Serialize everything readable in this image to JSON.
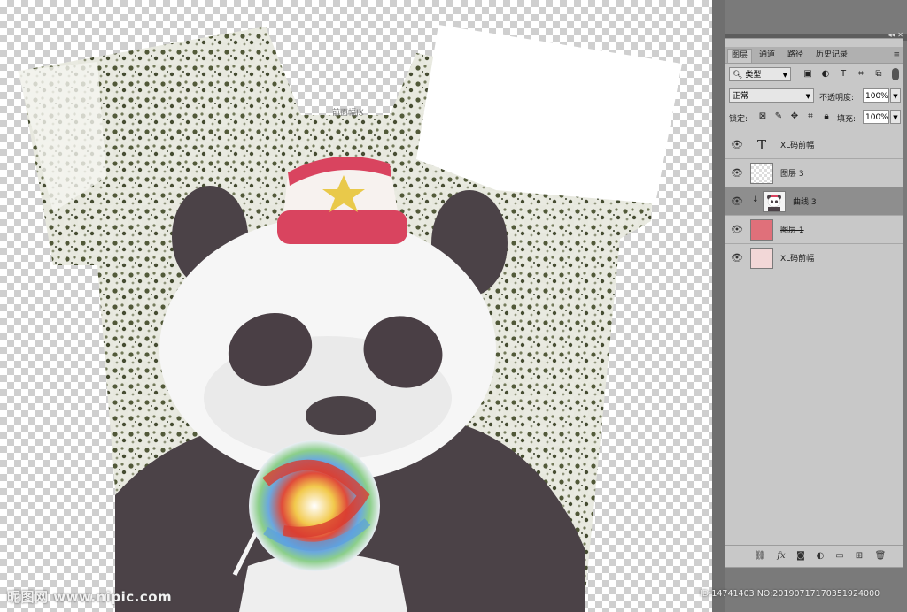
{
  "panel": {
    "tabs": [
      "图层",
      "通道",
      "路径",
      "历史记录"
    ],
    "filter": {
      "value": "类型"
    },
    "blend_mode": "正常",
    "opacity_label": "不透明度:",
    "opacity_value": "100%",
    "lock_label": "锁定:",
    "fill_label": "填充:",
    "fill_value": "100%",
    "layers": [
      {
        "name": "XL码前幅",
        "kind": "text"
      },
      {
        "name": "图层 3",
        "kind": "transparent"
      },
      {
        "name": "曲线 3",
        "kind": "adjustment",
        "selected": true,
        "clipped": true
      },
      {
        "name": "图层 1",
        "kind": "pink",
        "strikethrough": true
      },
      {
        "name": "XL码前幅",
        "kind": "lightpink"
      }
    ]
  },
  "canvas": {
    "artwork_label": "前面幅JX"
  },
  "watermark": "昵图网 www.nipic.com",
  "status": "ID:14741403 NO:20190717170351924000",
  "icons": {
    "eye": "eye-icon",
    "search": "search-icon",
    "panel_menu": "menu-icon"
  }
}
